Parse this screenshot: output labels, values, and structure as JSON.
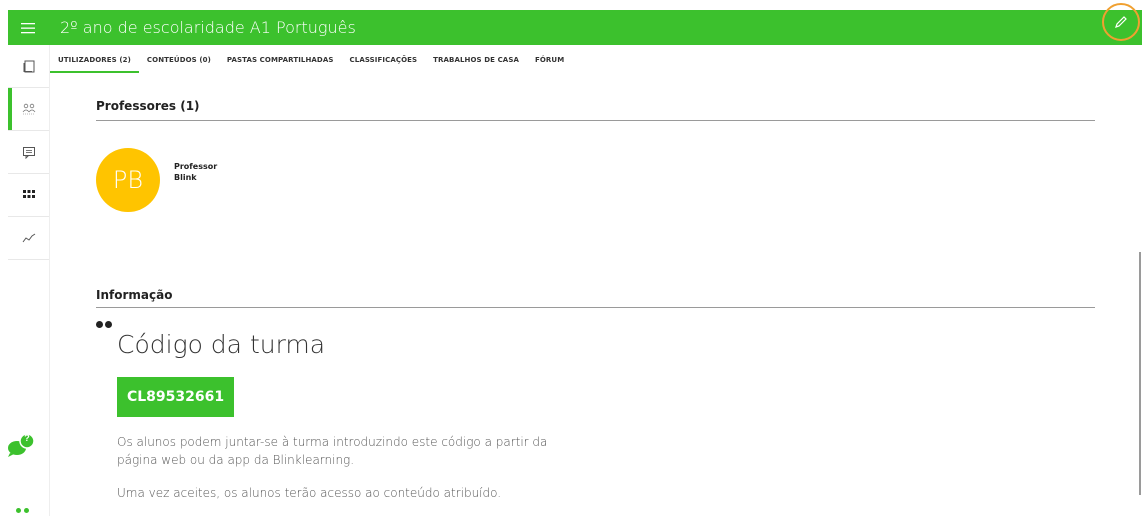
{
  "header": {
    "title": "2º ano de escolaridade A1 Português",
    "accent_color": "#3cc12d",
    "menu_icon": "hamburger-icon",
    "edit_icon": "pencil-icon"
  },
  "tabs": [
    {
      "label": "UTILIZADORES (2)",
      "active": true
    },
    {
      "label": "CONTEÚDOS (0)",
      "active": false
    },
    {
      "label": "PASTAS COMPARTILHADAS",
      "active": false
    },
    {
      "label": "CLASSIFICAÇÕES",
      "active": false
    },
    {
      "label": "TRABALHOS DE CASA",
      "active": false
    },
    {
      "label": "FÓRUM",
      "active": false
    }
  ],
  "sidebar": {
    "items": [
      {
        "icon": "book-icon"
      },
      {
        "icon": "users-icon",
        "active": true
      },
      {
        "icon": "chat-icon"
      },
      {
        "icon": "apps-grid-icon"
      },
      {
        "icon": "trend-line-icon"
      }
    ],
    "help_badge": "?"
  },
  "teachers": {
    "title": "Professores (1)",
    "list": [
      {
        "initials": "PB",
        "first_name": "Professor",
        "last_name": "Blink",
        "avatar_color": "#ffc400"
      }
    ]
  },
  "info": {
    "title": "Informação",
    "code_heading": "Código da turma",
    "code": "CL89532661",
    "paragraph1_line1": "Os alunos podem juntar-se à turma introduzindo este código a partir da",
    "paragraph1_line2": "página web ou da app da Blinklearning.",
    "paragraph2": "Uma vez aceites, os alunos terão acesso ao conteúdo atribuído."
  }
}
